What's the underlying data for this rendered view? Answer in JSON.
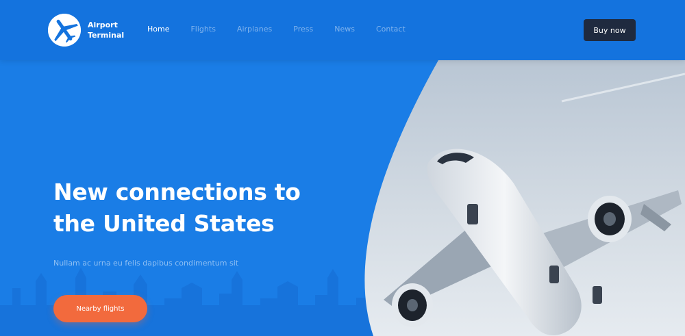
{
  "brand": {
    "name_line1": "Airport",
    "name_line2": "Terminal",
    "icon": "airplane-icon"
  },
  "nav": {
    "items": [
      {
        "label": "Home",
        "active": true
      },
      {
        "label": "Flights",
        "active": false
      },
      {
        "label": "Airplanes",
        "active": false
      },
      {
        "label": "Press",
        "active": false
      },
      {
        "label": "News",
        "active": false
      },
      {
        "label": "Contact",
        "active": false
      }
    ],
    "buy_label": "Buy now"
  },
  "hero": {
    "title_line1": "New connections to",
    "title_line2": "the United States",
    "subtitle": "Nullam ac urna eu felis dapibus condimentum sit",
    "cta_label": "Nearby flights",
    "image": "airplane-takeoff-photo"
  },
  "colors": {
    "background": "#1a7de6",
    "header": "#1473de",
    "buy_button": "#1f2a3f",
    "cta_button": "#f26a3d"
  }
}
